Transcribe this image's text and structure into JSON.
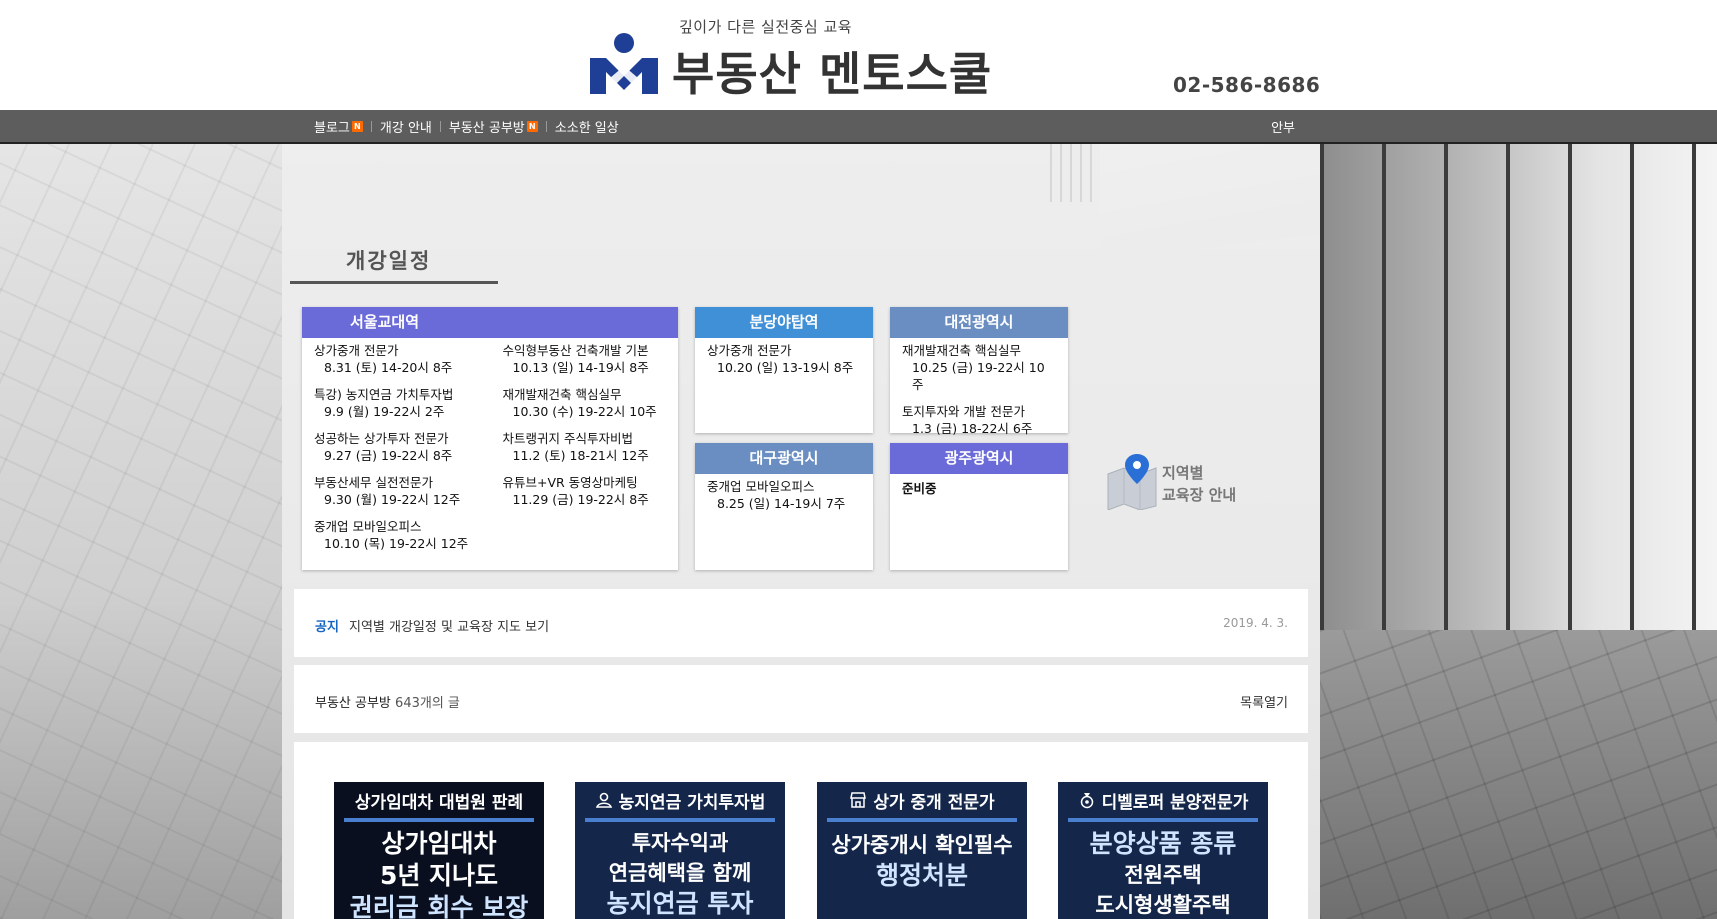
{
  "header": {
    "tagline": "깊이가 다른 실전중심 교육",
    "title": "부동산 멘토스쿨",
    "phone": "02-586-8686"
  },
  "nav": {
    "items": [
      {
        "label": "블로그",
        "badge": "N"
      },
      {
        "label": "개강 안내",
        "badge": ""
      },
      {
        "label": "부동산 공부방",
        "badge": "N"
      },
      {
        "label": "소소한 일상",
        "badge": ""
      }
    ],
    "right_label": "안부"
  },
  "section": {
    "title": "개강일정"
  },
  "schedules": {
    "seoul": {
      "name": "서울교대역",
      "color": "#6a6bd8",
      "left": [
        {
          "course": "상가중개 전문가",
          "when": "8.31 (토) 14-20시 8주"
        },
        {
          "course": "특강) 농지연금 가치투자법",
          "when": "9.9 (월) 19-22시 2주"
        },
        {
          "course": "성공하는 상가투자 전문가",
          "when": "9.27 (금) 19-22시 8주"
        },
        {
          "course": "부동산세무 실전전문가",
          "when": "9.30 (월) 19-22시 12주"
        },
        {
          "course": "중개업 모바일오피스",
          "when": "10.10 (목) 19-22시 12주"
        }
      ],
      "right": [
        {
          "course": "수익형부동산 건축개발 기본",
          "when": "10.13 (일) 14-19시 8주"
        },
        {
          "course": "재개발재건축 핵심실무",
          "when": "10.30 (수) 19-22시 10주"
        },
        {
          "course": "차트랭귀지 주식투자비법",
          "when": "11.2 (토) 18-21시 12주"
        },
        {
          "course": "유튜브+VR 동영상마케팅",
          "when": "11.29 (금) 19-22시 8주"
        }
      ]
    },
    "bundang": {
      "name": "분당야탑역",
      "color": "#3f90d6",
      "items": [
        {
          "course": "상가중개 전문가",
          "when": "10.20 (일) 13-19시 8주"
        }
      ]
    },
    "daejeon": {
      "name": "대전광역시",
      "color": "#6a8ec2",
      "items": [
        {
          "course": "재개발재건축 핵심실무",
          "when": "10.25 (금) 19-22시 10주"
        },
        {
          "course": "토지투자와 개발 전문가",
          "when": "1.3 (금) 18-22시 6주"
        }
      ]
    },
    "daegu": {
      "name": "대구광역시",
      "color": "#6a8ec2",
      "items": [
        {
          "course": "중개업 모바일오피스",
          "when": "8.25 (일) 14-19시 7주"
        }
      ]
    },
    "gwangju": {
      "name": "광주광역시",
      "color": "#6a6bd8",
      "status": "준비중"
    }
  },
  "region_guide": {
    "line1": "지역별",
    "line2": "교육장 안내"
  },
  "notice": {
    "label": "공지",
    "text": "지역별 개강일정 및 교육장 지도 보기",
    "date": "2019. 4. 3."
  },
  "post_list": {
    "category": "부동산 공부방",
    "count": "643개의 글",
    "toggle": "목록열기"
  },
  "thumbnails": [
    {
      "header": "상가임대차 대법원 판례",
      "icon": "",
      "lines": [
        "상가임대차",
        "5년 지나도",
        "권리금 회수 보장"
      ],
      "dark": true
    },
    {
      "header": "농지연금 가치투자법",
      "icon": "person-icon",
      "lines": [
        "투자수익과",
        "연금혜택을 함께",
        "농지연금 투자"
      ],
      "dark": false
    },
    {
      "header": "상가 중개 전문가",
      "icon": "store-icon",
      "lines": [
        "상가중개시 확인필수",
        "행정처분"
      ],
      "dark": false
    },
    {
      "header": "디벨로퍼 분양전문가",
      "icon": "bag-icon",
      "lines": [
        "분양상품 종류",
        "전원주택",
        "도시형생활주택"
      ],
      "dark": false
    }
  ]
}
